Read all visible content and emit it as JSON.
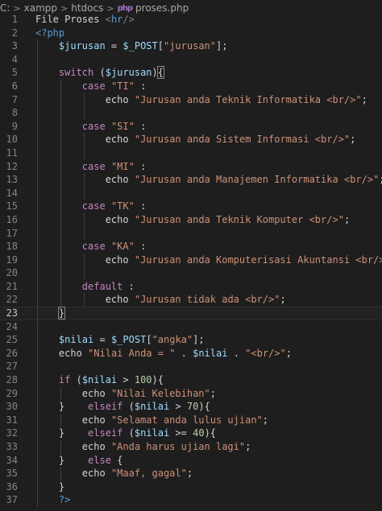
{
  "breadcrumb": {
    "drive": "C:",
    "folder1": "xampp",
    "folder2": "htdocs",
    "file_icon": "php-file-icon",
    "file_icon_glyph": "php",
    "file": "proses.php",
    "separator": ">"
  },
  "lines": [
    {
      "n": "1",
      "tokens": [
        [
          "text",
          "File Proses "
        ],
        [
          "tag",
          "<"
        ],
        [
          "tagname",
          "hr"
        ],
        [
          "tag",
          "/>"
        ]
      ]
    },
    {
      "n": "2",
      "tokens": [
        [
          "phptag",
          "<?php"
        ]
      ]
    },
    {
      "n": "3",
      "tokens": [
        [
          "ws",
          "    "
        ],
        [
          "var",
          "$jurusan"
        ],
        [
          "op",
          " = "
        ],
        [
          "var",
          "$_POST"
        ],
        [
          "op",
          "["
        ],
        [
          "str",
          "\"jurusan\""
        ],
        [
          "op",
          "];"
        ]
      ]
    },
    {
      "n": "4",
      "tokens": []
    },
    {
      "n": "5",
      "tokens": [
        [
          "ws",
          "    "
        ],
        [
          "kw",
          "switch"
        ],
        [
          "op",
          " ("
        ],
        [
          "var",
          "$jurusan"
        ],
        [
          "op",
          ")"
        ],
        [
          "brhl",
          "{"
        ]
      ]
    },
    {
      "n": "6",
      "tokens": [
        [
          "ws",
          "        "
        ],
        [
          "kw",
          "case"
        ],
        [
          "op",
          " "
        ],
        [
          "str",
          "\"TI\""
        ],
        [
          "op",
          " :"
        ]
      ]
    },
    {
      "n": "7",
      "tokens": [
        [
          "ws",
          "            "
        ],
        [
          "fn",
          "echo"
        ],
        [
          "op",
          " "
        ],
        [
          "str",
          "\"Jurusan anda Teknik Informatika <br/>\""
        ],
        [
          "op",
          ";"
        ]
      ]
    },
    {
      "n": "8",
      "tokens": []
    },
    {
      "n": "9",
      "tokens": [
        [
          "ws",
          "        "
        ],
        [
          "kw",
          "case"
        ],
        [
          "op",
          " "
        ],
        [
          "str",
          "\"SI\""
        ],
        [
          "op",
          " :"
        ]
      ]
    },
    {
      "n": "10",
      "tokens": [
        [
          "ws",
          "            "
        ],
        [
          "fn",
          "echo"
        ],
        [
          "op",
          " "
        ],
        [
          "str",
          "\"Jurusan anda Sistem Informasi <br/>\""
        ],
        [
          "op",
          ";"
        ]
      ]
    },
    {
      "n": "11",
      "tokens": []
    },
    {
      "n": "12",
      "tokens": [
        [
          "ws",
          "        "
        ],
        [
          "kw",
          "case"
        ],
        [
          "op",
          " "
        ],
        [
          "str",
          "\"MI\""
        ],
        [
          "op",
          " :"
        ]
      ]
    },
    {
      "n": "13",
      "tokens": [
        [
          "ws",
          "            "
        ],
        [
          "fn",
          "echo"
        ],
        [
          "op",
          " "
        ],
        [
          "str",
          "\"Jurusan anda Manajemen Informatika <br/>\""
        ],
        [
          "op",
          ";"
        ]
      ]
    },
    {
      "n": "14",
      "tokens": []
    },
    {
      "n": "15",
      "tokens": [
        [
          "ws",
          "        "
        ],
        [
          "kw",
          "case"
        ],
        [
          "op",
          " "
        ],
        [
          "str",
          "\"TK\""
        ],
        [
          "op",
          " :"
        ]
      ]
    },
    {
      "n": "16",
      "tokens": [
        [
          "ws",
          "            "
        ],
        [
          "fn",
          "echo"
        ],
        [
          "op",
          " "
        ],
        [
          "str",
          "\"Jurusan anda Teknik Komputer <br/>\""
        ],
        [
          "op",
          ";"
        ]
      ]
    },
    {
      "n": "17",
      "tokens": []
    },
    {
      "n": "18",
      "tokens": [
        [
          "ws",
          "        "
        ],
        [
          "kw",
          "case"
        ],
        [
          "op",
          " "
        ],
        [
          "str",
          "\"KA\""
        ],
        [
          "op",
          " :"
        ]
      ]
    },
    {
      "n": "19",
      "tokens": [
        [
          "ws",
          "            "
        ],
        [
          "fn",
          "echo"
        ],
        [
          "op",
          " "
        ],
        [
          "str",
          "\"Jurusan anda Komputerisasi Akuntansi <br/>\""
        ],
        [
          "op",
          ";"
        ]
      ]
    },
    {
      "n": "20",
      "tokens": []
    },
    {
      "n": "21",
      "tokens": [
        [
          "ws",
          "        "
        ],
        [
          "kw",
          "default"
        ],
        [
          "op",
          " :"
        ]
      ]
    },
    {
      "n": "22",
      "tokens": [
        [
          "ws",
          "            "
        ],
        [
          "fn",
          "echo"
        ],
        [
          "op",
          " "
        ],
        [
          "str",
          "\"Jurusan tidak ada <br/>\""
        ],
        [
          "op",
          ";"
        ]
      ]
    },
    {
      "n": "23",
      "tokens": [
        [
          "ws",
          "    "
        ],
        [
          "brhl",
          "}"
        ]
      ],
      "active": true
    },
    {
      "n": "24",
      "tokens": []
    },
    {
      "n": "25",
      "tokens": [
        [
          "ws",
          "    "
        ],
        [
          "var",
          "$nilai"
        ],
        [
          "op",
          " = "
        ],
        [
          "var",
          "$_POST"
        ],
        [
          "op",
          "["
        ],
        [
          "str",
          "\"angka\""
        ],
        [
          "op",
          "];"
        ]
      ]
    },
    {
      "n": "26",
      "tokens": [
        [
          "ws",
          "    "
        ],
        [
          "fn",
          "echo"
        ],
        [
          "op",
          " "
        ],
        [
          "str",
          "\"Nilai Anda = \""
        ],
        [
          "op",
          " . "
        ],
        [
          "var",
          "$nilai"
        ],
        [
          "op",
          " . "
        ],
        [
          "str",
          "\"<br/>\""
        ],
        [
          "op",
          ";"
        ]
      ]
    },
    {
      "n": "27",
      "tokens": []
    },
    {
      "n": "28",
      "tokens": [
        [
          "ws",
          "    "
        ],
        [
          "kw",
          "if"
        ],
        [
          "op",
          " ("
        ],
        [
          "var",
          "$nilai"
        ],
        [
          "op",
          " > "
        ],
        [
          "num",
          "100"
        ],
        [
          "op",
          "){"
        ]
      ]
    },
    {
      "n": "29",
      "tokens": [
        [
          "ws",
          "        "
        ],
        [
          "fn",
          "echo"
        ],
        [
          "op",
          " "
        ],
        [
          "str",
          "\"Nilai Kelebihan\""
        ],
        [
          "op",
          ";"
        ]
      ]
    },
    {
      "n": "30",
      "tokens": [
        [
          "ws",
          "    "
        ],
        [
          "op",
          "}"
        ],
        [
          "ws",
          "    "
        ],
        [
          "kw",
          "elseif"
        ],
        [
          "op",
          " ("
        ],
        [
          "var",
          "$nilai"
        ],
        [
          "op",
          " > "
        ],
        [
          "num",
          "70"
        ],
        [
          "op",
          "){"
        ]
      ]
    },
    {
      "n": "31",
      "tokens": [
        [
          "ws",
          "        "
        ],
        [
          "fn",
          "echo"
        ],
        [
          "op",
          " "
        ],
        [
          "str",
          "\"Selamat anda lulus ujian\""
        ],
        [
          "op",
          ";"
        ]
      ]
    },
    {
      "n": "32",
      "tokens": [
        [
          "ws",
          "    "
        ],
        [
          "op",
          "}"
        ],
        [
          "ws",
          "    "
        ],
        [
          "kw",
          "elseif"
        ],
        [
          "op",
          " ("
        ],
        [
          "var",
          "$nilai"
        ],
        [
          "op",
          " >= "
        ],
        [
          "num",
          "40"
        ],
        [
          "op",
          "){"
        ]
      ]
    },
    {
      "n": "33",
      "tokens": [
        [
          "ws",
          "        "
        ],
        [
          "fn",
          "echo"
        ],
        [
          "op",
          " "
        ],
        [
          "str",
          "\"Anda harus ujian lagi\""
        ],
        [
          "op",
          ";"
        ]
      ]
    },
    {
      "n": "34",
      "tokens": [
        [
          "ws",
          "    "
        ],
        [
          "op",
          "}"
        ],
        [
          "ws",
          "    "
        ],
        [
          "kw",
          "else"
        ],
        [
          "op",
          " {"
        ]
      ]
    },
    {
      "n": "35",
      "tokens": [
        [
          "ws",
          "        "
        ],
        [
          "fn",
          "echo"
        ],
        [
          "op",
          " "
        ],
        [
          "str",
          "\"Maaf, gagal\""
        ],
        [
          "op",
          ";"
        ]
      ]
    },
    {
      "n": "36",
      "tokens": [
        [
          "ws",
          "    "
        ],
        [
          "op",
          "}"
        ]
      ]
    },
    {
      "n": "37",
      "tokens": [
        [
          "ws",
          "    "
        ],
        [
          "phptag",
          "?>"
        ]
      ]
    }
  ],
  "colors": {
    "background": "#1e1e1e",
    "keyword": "#c586c0",
    "variable": "#9cdcfe",
    "string": "#ce9178",
    "number": "#b5cea8",
    "php_tag": "#569cd6",
    "line_number": "#858585"
  }
}
